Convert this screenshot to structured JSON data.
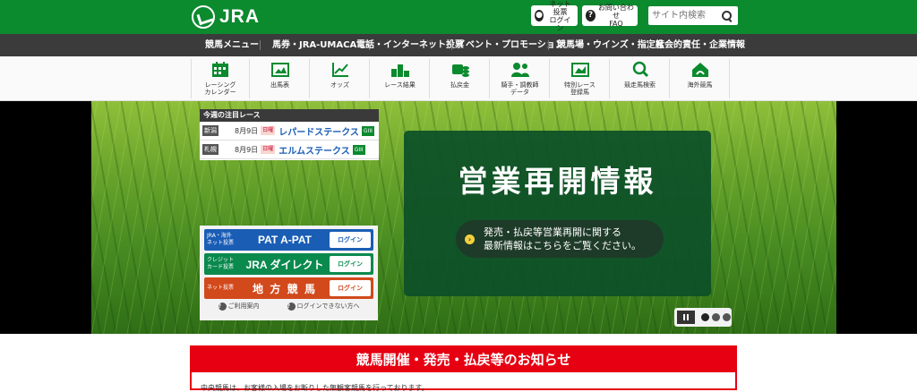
{
  "header": {
    "logo_text": "JRA",
    "net_vote_login_line1": "ネット投票",
    "net_vote_login_line2": "ログイン",
    "faq_line1": "お問い合わせ",
    "faq_line2": "FAQ",
    "search_placeholder": "サイト内検索",
    "brand_color": "#0b8a2e"
  },
  "menu": [
    "競馬メニュー",
    "馬券・JRA-UMACA",
    "電話・インターネット投票",
    "イベント・プロモーション",
    "競馬場・ウインズ・指定席",
    "社会的責任・企業情報"
  ],
  "nav": [
    {
      "label": "レーシング\nカレンダー",
      "icon": "calendar-icon"
    },
    {
      "label": "出馬表",
      "icon": "racecard-icon"
    },
    {
      "label": "オッズ",
      "icon": "odds-chart-icon"
    },
    {
      "label": "レース結果",
      "icon": "podium-icon"
    },
    {
      "label": "払戻金",
      "icon": "payout-icon"
    },
    {
      "label": "騎手・調教師\nデータ",
      "icon": "jockey-icon"
    },
    {
      "label": "特別レース\n登録馬",
      "icon": "special-race-icon"
    },
    {
      "label": "競走馬検索",
      "icon": "horse-search-icon"
    },
    {
      "label": "海外競馬",
      "icon": "overseas-icon"
    }
  ],
  "featured": {
    "title": "今週の注目レース",
    "races": [
      {
        "venue": "新潟",
        "date": "8月9日",
        "day": "日曜",
        "name": "レパードステークス",
        "grade": "GIII"
      },
      {
        "venue": "札幌",
        "date": "8月9日",
        "day": "日曜",
        "name": "エルムステークス",
        "grade": "GIII"
      }
    ]
  },
  "pat": {
    "rows": [
      {
        "label": "JRA・海外\nネット投票",
        "brand": "PAT A-PAT",
        "login": "ログイン"
      },
      {
        "label": "クレジット\nカード投票",
        "brand": "JRA ダイレクト",
        "login": "ログイン"
      },
      {
        "label": "ネット投票",
        "brand": "地 方 競 馬",
        "login": "ログイン"
      }
    ],
    "help": "ご利用案内",
    "cant_login": "ログインできない方へ"
  },
  "banner": {
    "title": "営業再開情報",
    "link_line1": "発売・払戻等営業再開に関する",
    "link_line2": "最新情報はこちらをご覧ください。"
  },
  "notice": {
    "title": "競馬開催・発売・払戻等のお知らせ",
    "text": "中央競馬は、お客様の入場をお断りした無観客競馬を行っております。"
  }
}
